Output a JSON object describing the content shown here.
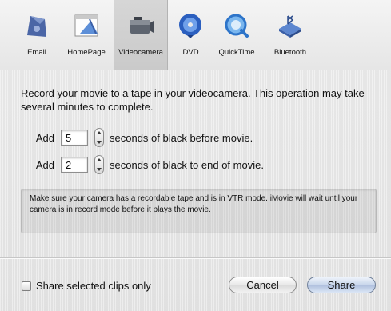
{
  "toolbar": {
    "items": [
      {
        "label": "Email",
        "icon": "email-icon"
      },
      {
        "label": "HomePage",
        "icon": "homepage-icon"
      },
      {
        "label": "Videocamera",
        "icon": "videocamera-icon"
      },
      {
        "label": "iDVD",
        "icon": "idvd-icon"
      },
      {
        "label": "QuickTime",
        "icon": "quicktime-icon"
      },
      {
        "label": "Bluetooth",
        "icon": "bluetooth-icon"
      }
    ],
    "selected": "Videocamera"
  },
  "description": "Record your movie to a tape in your videocamera. This operation may take several minutes to complete.",
  "before": {
    "label": "Add",
    "value": "5",
    "suffix": "seconds of black before movie."
  },
  "after": {
    "label": "Add",
    "value": "2",
    "suffix": "seconds of black to end of movie."
  },
  "note": "Make sure your camera has a recordable tape and is in VTR mode. iMovie will wait until your camera is in record mode before it plays the movie.",
  "footer": {
    "checkbox_label": "Share selected clips only",
    "checkbox_checked": false,
    "cancel_label": "Cancel",
    "share_label": "Share"
  }
}
